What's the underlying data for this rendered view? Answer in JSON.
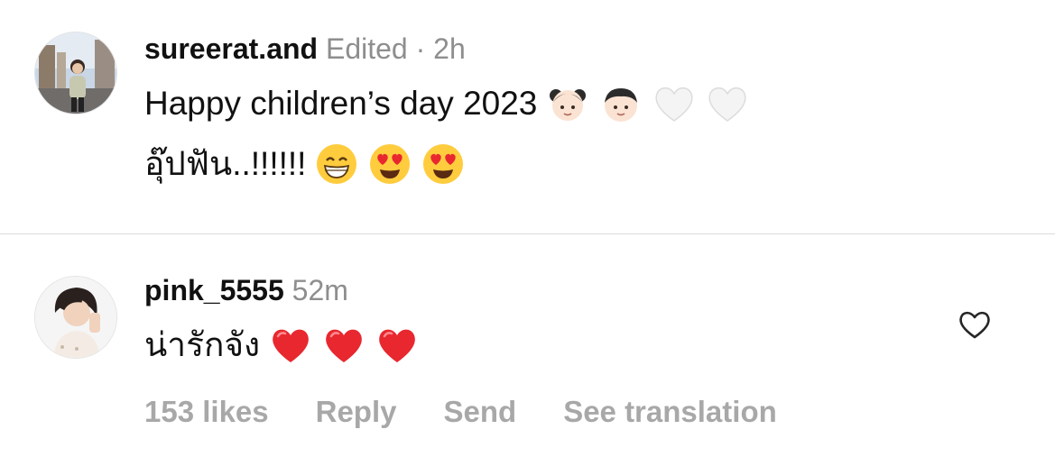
{
  "comments": [
    {
      "username": "sureerat.and",
      "edited": "Edited",
      "separator": "·",
      "time": "2h",
      "lines": [
        "Happy children’s day 2023",
        "อุ๊ปฟัน..!!!!!!"
      ],
      "line1_emojis": [
        "girl-face-emoji",
        "boy-face-emoji",
        "white-heart-emoji",
        "white-heart-emoji"
      ],
      "line2_emojis": [
        "grinning-face-emoji",
        "heart-eyes-emoji",
        "heart-eyes-emoji"
      ]
    },
    {
      "username": "pink_5555",
      "time": "52m",
      "lines": [
        "น่ารักจัง"
      ],
      "line1_emojis": [
        "red-heart-emoji",
        "red-heart-emoji",
        "red-heart-emoji"
      ],
      "likes": "153 likes",
      "reply": "Reply",
      "send": "Send",
      "see_translation": "See translation",
      "like_icon": "heart-outline-icon"
    }
  ],
  "colors": {
    "muted_text": "#8e8e8e",
    "action_text": "#a8a8a8",
    "divider": "#dbdbdb",
    "red_heart": "#e8272f"
  }
}
